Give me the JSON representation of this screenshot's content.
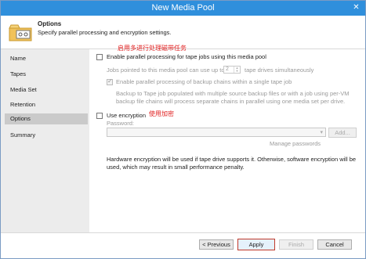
{
  "window": {
    "title": "New Media Pool",
    "close_glyph": "✕"
  },
  "header": {
    "title": "Options",
    "subtitle": "Specify parallel processing and encryption settings.",
    "icon": "media-pool-icon"
  },
  "sidebar": {
    "items": [
      {
        "label": "Name",
        "active": false
      },
      {
        "label": "Tapes",
        "active": false
      },
      {
        "label": "Media Set",
        "active": false
      },
      {
        "label": "Retention",
        "active": false
      },
      {
        "label": "Options",
        "active": true
      },
      {
        "label": "Summary",
        "active": false
      }
    ]
  },
  "content": {
    "annotation_parallel": "启用多进行处理磁带任务",
    "parallel_label": "Enable parallel processing for tape jobs using this media pool",
    "parallel_checked": false,
    "jobs_prefix": "Jobs pointed to this media pool can use up to",
    "drives_value": "2",
    "jobs_suffix": "tape drives simultaneously",
    "chains_label": "Enable parallel processing of backup chains within a single tape job",
    "chains_checked": true,
    "chains_desc1": "Backup to Tape job populated with multiple source backup files or with a job using per-VM",
    "chains_desc2": "backup file chains will process separate chains in parallel using one media set per drive.",
    "annotation_encryption": "使用加密",
    "encryption_label": "Use encryption",
    "encryption_checked": false,
    "password_label": "Password:",
    "password_value": "",
    "add_button": "Add...",
    "manage_passwords": "Manage passwords",
    "hw_note1": "Hardware encryption will be used if tape drive supports it. Otherwise, software encryption will be",
    "hw_note2": "used, which may result in small performance penalty."
  },
  "footer": {
    "previous": "< Previous",
    "apply": "Apply",
    "finish": "Finish",
    "cancel": "Cancel"
  },
  "colors": {
    "titlebar": "#2f8fdc",
    "annotation": "#e02020",
    "apply_border": "#c0392b"
  }
}
